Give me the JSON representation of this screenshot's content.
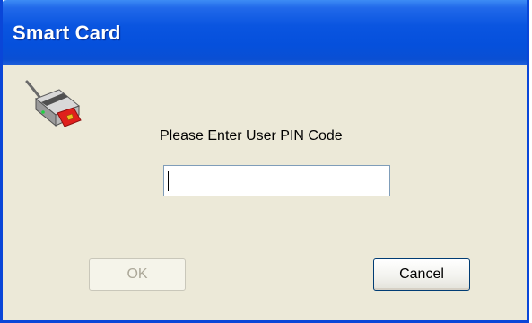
{
  "window": {
    "title": "Smart Card"
  },
  "dialog": {
    "prompt": "Please Enter User PIN Code",
    "pin_value": "",
    "ok_label": "OK",
    "ok_enabled": false,
    "cancel_label": "Cancel"
  },
  "icons": {
    "main": "smart-card-reader-icon"
  },
  "colors": {
    "titlebar": "#0a55e0",
    "frame": "#0a46d8",
    "client": "#ece9d8",
    "input_border": "#7f9db9",
    "disabled_text": "#aca899",
    "button_border": "#003c74"
  }
}
